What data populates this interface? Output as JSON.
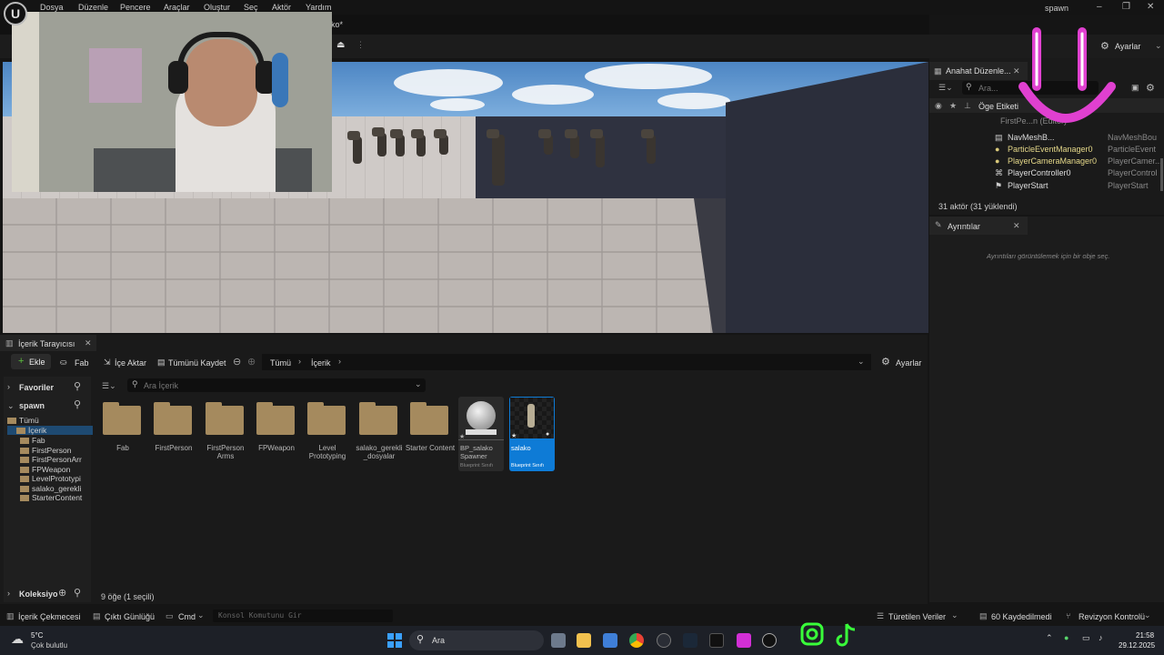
{
  "menu": {
    "items": [
      "Dosya",
      "Düzenle",
      "Pencere",
      "Araçlar",
      "Oluştur",
      "Seç",
      "Aktör",
      "Yardım"
    ],
    "project_tab_suffix": "ko*",
    "window_title": "spawn"
  },
  "toolbar": {
    "settings_label": "Ayarlar"
  },
  "outliner": {
    "tab_label": "Anahat Düzenle...",
    "search_placeholder": "Ara...",
    "column_label": "Öge Etiketi",
    "rows": [
      {
        "label": "FirstPe...n (Editör)",
        "type": ""
      },
      {
        "label": "NavMeshB...",
        "type": "NavMeshBou"
      },
      {
        "label": "ParticleEventManager0",
        "type": "ParticleEvent"
      },
      {
        "label": "PlayerCameraManager0",
        "type": "PlayerCamer..."
      },
      {
        "label": "PlayerController0",
        "type": "PlayerControl"
      },
      {
        "label": "PlayerStart",
        "type": "PlayerStart"
      }
    ],
    "footer": "31 aktör (31 yüklendi)"
  },
  "details": {
    "tab_label": "Ayrıntılar",
    "empty_message": "Ayrıntıları görüntülemek için bir obje seç."
  },
  "content_browser": {
    "tab_label": "İçerik Tarayıcısı",
    "add_label": "Ekle",
    "fab_label": "Fab",
    "import_label": "İçe Aktar",
    "save_all_label": "Tümünü Kaydet",
    "breadcrumb": [
      "Tümü",
      "İçerik"
    ],
    "settings_label": "Ayarlar",
    "search_placeholder": "Ara İçerik",
    "favorites_label": "Favoriler",
    "project_label": "spawn",
    "tree": [
      "Tümü",
      "İçerik",
      "Fab",
      "FirstPerson",
      "FirstPersonArr",
      "FPWeapon",
      "LevelPrototypi",
      "salako_gerekli",
      "StarterContent"
    ],
    "folders": [
      {
        "label": "Fab"
      },
      {
        "label": "FirstPerson"
      },
      {
        "label": "FirstPerson Arms"
      },
      {
        "label": "FPWeapon"
      },
      {
        "label": "Level Prototyping"
      },
      {
        "label": "salako_gerekli _dosyalar"
      },
      {
        "label": "Starter Content"
      }
    ],
    "assets": [
      {
        "label": "BP_salako Spawner",
        "type": "Blueprint Sınıfı"
      },
      {
        "label": "salako",
        "type": "Blueprint Sınıfı"
      }
    ],
    "collections_label": "Koleksiyo",
    "item_count": "9 öğe (1 seçili)"
  },
  "statusbar": {
    "drawer": "İçerik Çekmecesi",
    "output_log": "Çıktı Günlüğü",
    "cmd": "Cmd",
    "console_placeholder": "Konsol Komutunu Gir",
    "derived_data": "Türetilen Veriler",
    "unsaved": "60 Kaydedilmedi",
    "revision": "Revizyon Kontrolü"
  },
  "taskbar": {
    "weather_temp": "5°C",
    "weather_desc": "Çok bulutlu",
    "search_label": "Ara",
    "time": "21:58",
    "date": "29.12.2025"
  },
  "colors": {
    "accent": "#0e7bd6",
    "folder": "#a58a5e",
    "overlay_pink": "#e040d0"
  }
}
